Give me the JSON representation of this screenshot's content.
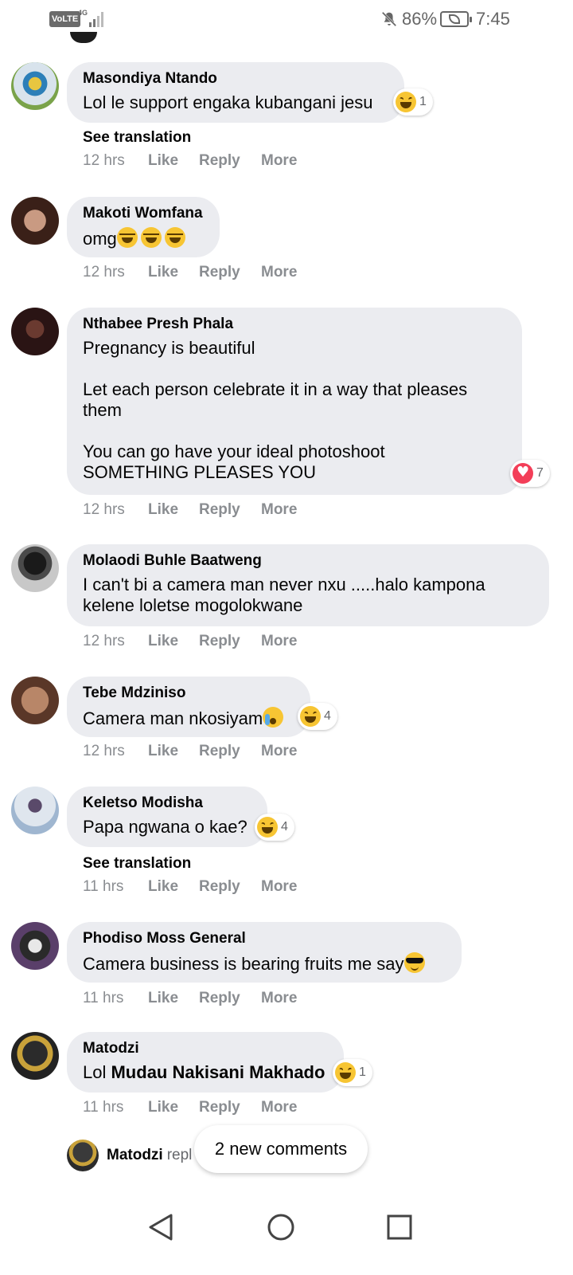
{
  "status_bar": {
    "volte": "VoLTE",
    "network": "4G",
    "battery_percent": "86%",
    "time": "7:45"
  },
  "comments": [
    {
      "author": "Masondiya Ntando",
      "text": "Lol le support engaka kubangani jesu",
      "reaction": {
        "type": "haha",
        "count": "1"
      },
      "see_translation": "See translation",
      "time": "12 hrs"
    },
    {
      "author": "Makoti Womfana",
      "text": "omg",
      "time": "12 hrs"
    },
    {
      "author": "Nthabee Presh Phala",
      "text": "Pregnancy is beautiful\n\nLet each person celebrate it in a way that pleases them\n\nYou can go have your ideal photoshoot\nSOMETHING PLEASES YOU",
      "reaction": {
        "type": "love",
        "count": "7"
      },
      "time": "12 hrs"
    },
    {
      "author": "Molaodi Buhle Baatweng",
      "text": "I can't bi a camera man never nxu .....halo kampona kelene loletse mogolokwane",
      "time": "12 hrs"
    },
    {
      "author": "Tebe Mdziniso",
      "text": "Camera man nkosiyam",
      "reaction": {
        "type": "haha",
        "count": "4"
      },
      "time": "12 hrs"
    },
    {
      "author": "Keletso Modisha",
      "text": "Papa ngwana o kae?",
      "reaction": {
        "type": "haha",
        "count": "4"
      },
      "see_translation": "See translation",
      "time": "11 hrs"
    },
    {
      "author": "Phodiso Moss General",
      "text": "Camera business is bearing fruits me say",
      "time": "11 hrs"
    },
    {
      "author": "Matodzi",
      "text_prefix": "Lol",
      "mention": "Mudau Nakisani Makhado",
      "reaction": {
        "type": "haha",
        "count": "1"
      },
      "time": "11 hrs"
    }
  ],
  "actions": {
    "like": "Like",
    "reply": "Reply",
    "more": "More"
  },
  "reply_preview": {
    "author": "Matodzi",
    "text": "repl"
  },
  "new_comments_label": "2 new comments",
  "colors": {
    "bubble": "#ebecf0",
    "meta_text": "#8a8d91",
    "haha": "#f7c533",
    "love": "#f33e58"
  }
}
